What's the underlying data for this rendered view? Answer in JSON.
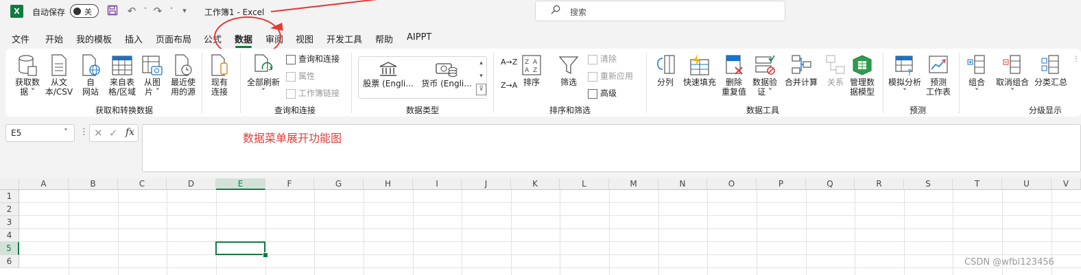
{
  "titlebar": {
    "app_icon": "X",
    "autosave_label": "自动保存",
    "autosave_state": "关",
    "doc_title": "工作簿1  -  Excel",
    "search_placeholder": "搜索",
    "icons": [
      "save-icon",
      "undo-icon",
      "redo-icon",
      "customize-qat-icon",
      "search-icon"
    ]
  },
  "menu": {
    "tabs": [
      "文件",
      "开始",
      "我的模板",
      "插入",
      "页面布局",
      "公式",
      "数据",
      "审阅",
      "视图",
      "开发工具",
      "帮助",
      "AIPPT"
    ],
    "active": "数据"
  },
  "ribbon": {
    "get_data": {
      "group_label": "获取和转换数据",
      "buttons": [
        {
          "line1": "获取数",
          "line2": "据 ˅"
        },
        {
          "line1": "从文",
          "line2": "本/CSV"
        },
        {
          "line1": "自",
          "line2": "网站"
        },
        {
          "line1": "来自表",
          "line2": "格/区域"
        },
        {
          "line1": "从图",
          "line2": "片 ˅"
        },
        {
          "line1": "最近使",
          "line2": "用的源"
        },
        {
          "line1": "现有",
          "line2": "连接"
        }
      ]
    },
    "queries": {
      "group_label": "查询和连接",
      "refresh_all": {
        "line1": "全部刷新",
        "line2": "˅"
      },
      "items": [
        "查询和连接",
        "属性",
        "工作簿链接"
      ]
    },
    "data_types": {
      "group_label": "数据类型",
      "items": [
        "股票 (Engli...",
        "货币 (Engli..."
      ]
    },
    "sort_filter": {
      "group_label": "排序和筛选",
      "sort_az": "A→Z",
      "sort_za": "Z→A",
      "sort": "排序",
      "filter": "筛选",
      "clear": "清除",
      "reapply": "重新应用",
      "advanced": "高级"
    },
    "data_tools": {
      "group_label": "数据工具",
      "buttons": [
        {
          "line1": "分列",
          "line2": ""
        },
        {
          "line1": "快速填充",
          "line2": ""
        },
        {
          "line1": "删除",
          "line2": "重复值"
        },
        {
          "line1": "数据验",
          "line2": "证 ˅"
        },
        {
          "line1": "合并计算",
          "line2": ""
        },
        {
          "line1": "关系",
          "line2": ""
        },
        {
          "line1": "管理数",
          "line2": "据模型"
        }
      ]
    },
    "forecast": {
      "group_label": "预测",
      "buttons": [
        {
          "line1": "模拟分析",
          "line2": "˅"
        },
        {
          "line1": "预测",
          "line2": "工作表"
        }
      ]
    },
    "outline": {
      "group_label": "分级显示",
      "buttons": [
        {
          "line1": "组合",
          "line2": "˅"
        },
        {
          "line1": "取消组合",
          "line2": "˅"
        },
        {
          "line1": "分类汇总",
          "line2": ""
        }
      ]
    }
  },
  "formula_bar": {
    "name_box": "E5",
    "fx": "fx",
    "annotation": "数据菜单展开功能图"
  },
  "grid": {
    "columns": [
      "A",
      "B",
      "C",
      "D",
      "E",
      "F",
      "G",
      "H",
      "I",
      "J",
      "K",
      "L",
      "M",
      "N",
      "O",
      "P",
      "Q",
      "R",
      "S",
      "T",
      "U",
      "V"
    ],
    "rows": [
      "1",
      "2",
      "3",
      "4",
      "5",
      "6"
    ],
    "selected_cell": "E5"
  },
  "watermark": "CSDN @wfbl123456",
  "colors": {
    "accent": "#107c41",
    "annotation": "#e53935"
  }
}
